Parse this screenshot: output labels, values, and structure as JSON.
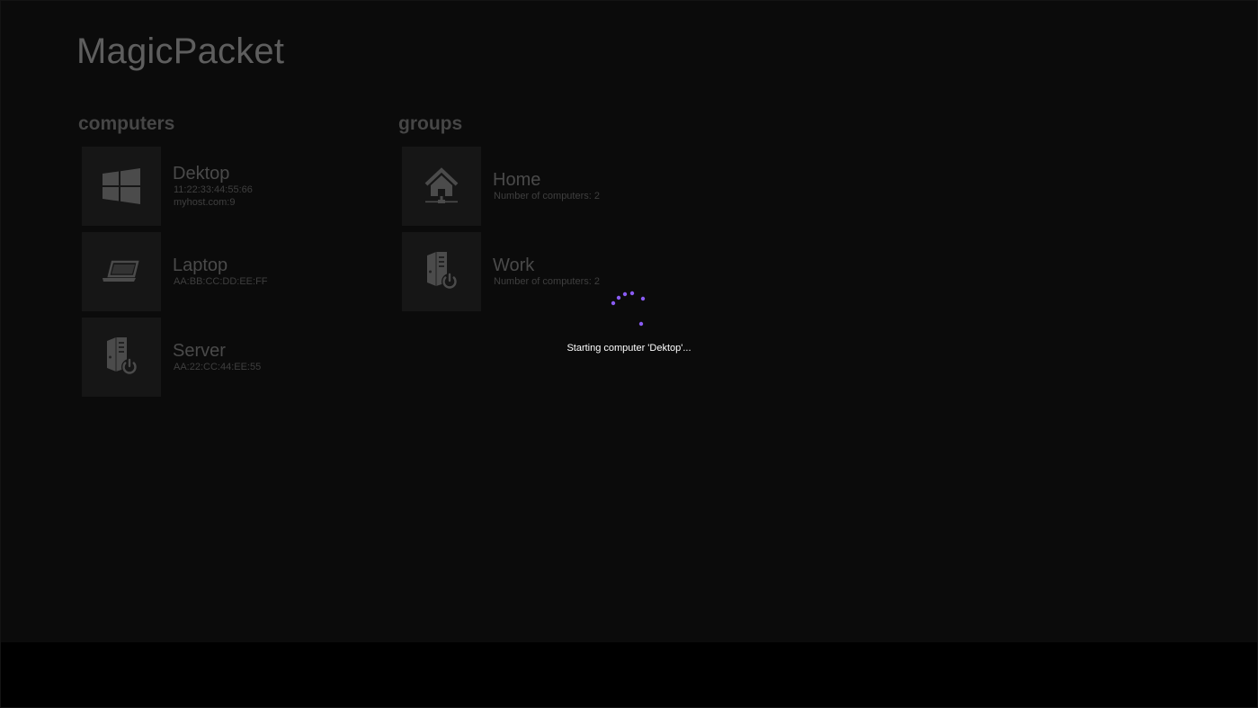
{
  "app": {
    "title": "MagicPacket"
  },
  "computers": {
    "header": "computers",
    "items": [
      {
        "name": "Dektop",
        "mac": "11:22:33:44:55:66",
        "host": "myhost.com:9",
        "icon": "windows-logo-icon"
      },
      {
        "name": "Laptop",
        "mac": "AA:BB:CC:DD:EE:FF",
        "icon": "laptop-icon"
      },
      {
        "name": "Server",
        "mac": "AA:22:CC:44:EE:55",
        "icon": "server-power-icon"
      }
    ]
  },
  "groups": {
    "header": "groups",
    "items": [
      {
        "name": "Home",
        "count": "Number of computers: 2",
        "icon": "home-network-icon"
      },
      {
        "name": "Work",
        "count": "Number of computers: 2",
        "icon": "server-power-icon"
      }
    ]
  },
  "overlay": {
    "status": "Starting computer 'Dektop'...",
    "spinner_color": "#8a5cf5"
  },
  "colors": {
    "background": "#0b0b0b",
    "tile": "#161616",
    "accent": "#8a5cf5"
  }
}
